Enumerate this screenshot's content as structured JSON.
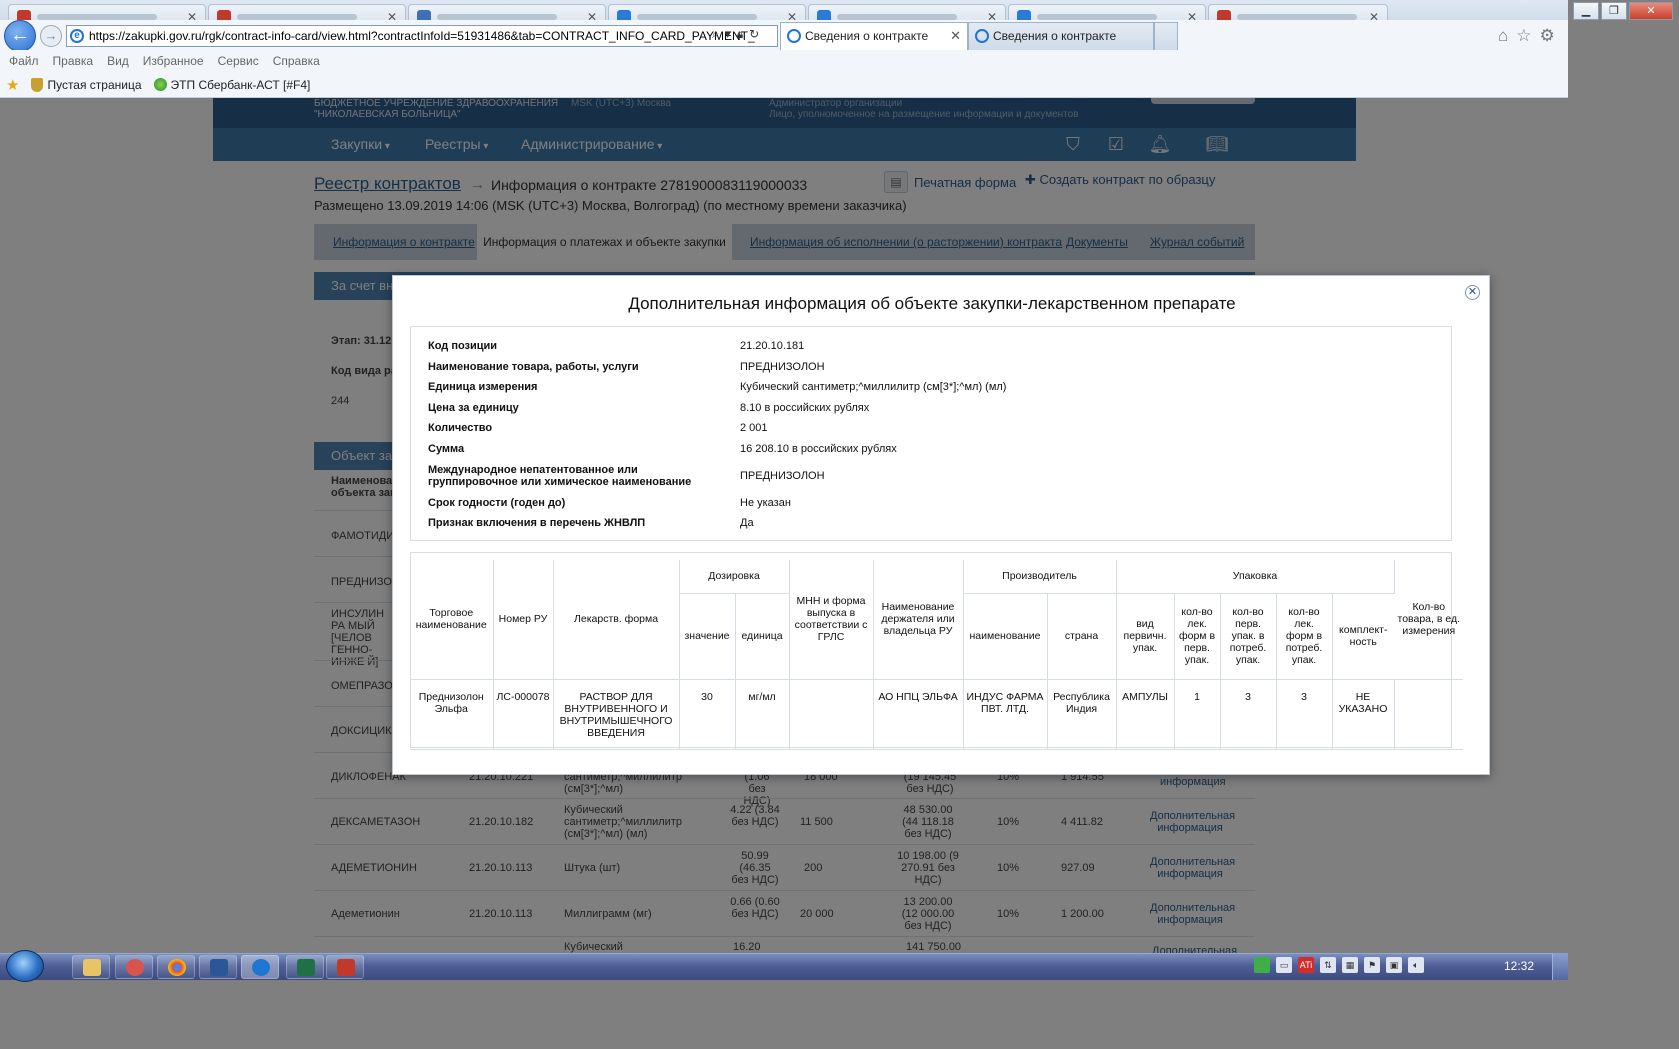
{
  "browser": {
    "url": "https://zakupki.gov.ru/rgk/contract-info-card/view.html?contractInfoId=51931486&tab=CONTRACT_INFO_CARD_PAYMENT_",
    "tab_active": "Сведения о контракте",
    "tab_other": "Сведения о контракте",
    "menu": [
      "Файл",
      "Правка",
      "Вид",
      "Избранное",
      "Сервис",
      "Справка"
    ],
    "favorites": [
      "Пустая страница",
      "ЭТП Сбербанк-АСТ [#F4]"
    ]
  },
  "site": {
    "org_line1": "БЮДЖЕТНОЕ УЧРЕЖДЕНИЕ ЗДРАВООХРАНЕНИЯ",
    "org_line2": "\"НИКОЛАЕВСКАЯ БОЛЬНИЦА\"",
    "timezone": "MSK (UTC+3) Москва",
    "role1": "Администратор организации",
    "role2": "Лицо, уполномоченное на размещение информации и документов",
    "nav": [
      "Закупки",
      "Реестры",
      "Администрирование"
    ]
  },
  "page": {
    "registry_link": "Реестр контрактов",
    "contract_title": "Информация о контракте 2781900083119000033",
    "print_form": "Печатная форма",
    "create_by_sample": "Создать контракт по образцу",
    "placed": "Размещено 13.09.2019 14:06 (MSK (UTC+3) Москва, Волгоград) (по местному времени заказчика)",
    "tabs": [
      "Информация о контракте",
      "Информация о платежах и объекте закупки",
      "Информация об исполнении (о расторжении) контракта",
      "Документы",
      "Журнал событий"
    ],
    "section1": "За счет вне",
    "stage": "Этап: 31.12.",
    "kod_vida": "Код вида ра",
    "kod_val": "244",
    "section2": "Объект зак",
    "col_name1": "Наименова",
    "col_name2": "объекта зак",
    "rows": [
      {
        "name": "ФАМОТИДИН"
      },
      {
        "name": "ПРЕДНИЗОЛО"
      },
      {
        "name": "ИНСУЛИН РА МЫЙ [ЧЕЛОВ ГЕННО-ИНЖЕ Й]"
      },
      {
        "name": "ОМЕПРАЗОЛ"
      },
      {
        "name": "ДОКСИЦИКЛ"
      },
      {
        "name": "ДИКЛОФЕНАК",
        "code": "21.20.10.221",
        "unit": "сантиметр;^миллилитр (см[3*];^мл)",
        "price": "(1.06 без НДС)",
        "qty": "18 000",
        "sum": "(19 145.45 без НДС)",
        "vat": "10%",
        "vat_sum": "1 914.55",
        "more": "информация"
      },
      {
        "name": "ДЕКСАМЕТАЗОН",
        "code": "21.20.10.182",
        "unit": "Кубический сантиметр;^миллилитр (см[3*];^мл) (мл)",
        "price": "4.22 (3.84 без НДС)",
        "qty": "11 500",
        "sum": "48 530.00 (44 118.18 без НДС)",
        "vat": "10%",
        "vat_sum": "4 411.82",
        "more": "Дополнительная информация"
      },
      {
        "name": "АДЕМЕТИОНИН",
        "code": "21.20.10.113",
        "unit": "Штука (шт)",
        "price": "50.99 (46.35 без НДС)",
        "qty": "200",
        "sum": "10 198.00 (9 270.91 без НДС)",
        "vat": "10%",
        "vat_sum": "927.09",
        "more": "Дополнительная информация"
      },
      {
        "name": "Адеметионин",
        "code": "21.20.10.113",
        "unit": "Миллиграмм (мг)",
        "price": "0.66 (0.60 без НДС)",
        "qty": "20 000",
        "sum": "13 200.00 (12 000.00 без НДС)",
        "vat": "10%",
        "vat_sum": "1 200.00",
        "more": "Дополнительная информация"
      },
      {
        "name": "",
        "unit": "Кубический",
        "price": "16.20",
        "sum": "141 750.00",
        "more": "Дополнительная"
      }
    ]
  },
  "modal": {
    "title": "Дополнительная информация об объекте закупки-лекарственном препарате",
    "fields": [
      {
        "label": "Код позиции",
        "value": "21.20.10.181"
      },
      {
        "label": "Наименование товара, работы, услуги",
        "value": "ПРЕДНИЗОЛОН"
      },
      {
        "label": "Единица измерения",
        "value": "Кубический сантиметр;^миллилитр (см[3*];^мл) (мл)"
      },
      {
        "label": "Цена за единицу",
        "value": "8.10 в российских рублях"
      },
      {
        "label": "Количество",
        "value": "2 001"
      },
      {
        "label": "Сумма",
        "value": "16 208.10 в российских рублях"
      },
      {
        "label": "Международное непатентованное или группировочное или химическое наименование",
        "value": "ПРЕДНИЗОЛОН"
      },
      {
        "label": "Срок годности (годен до)",
        "value": "Не указан"
      },
      {
        "label": "Признак включения в перечень ЖНВЛП",
        "value": "Да"
      }
    ],
    "table": {
      "group_dosage": "Дозировка",
      "group_manufacturer": "Производитель",
      "group_package": "Упаковка",
      "headers": {
        "trade_name": "Торговое наименование",
        "ru_number": "Номер РУ",
        "form": "Лекарств. форма",
        "dose_value": "значение",
        "dose_unit": "единица",
        "mnn": "МНН и форма выпуска в соответствии с ГРЛС",
        "holder": "Наименование держателя или владельца РУ",
        "mfr_name": "наименование",
        "mfr_country": "страна",
        "pack_type": "вид первичн. упак.",
        "pack_forms": "кол-во лек. форм в перв. упак.",
        "pack_cons": "кол-во перв. упак. в потреб. упак.",
        "pack_forms_cons": "кол-во лек. форм в потреб. упак.",
        "completeness": "комплект-ность",
        "qty_units": "Кол-во товара, в ед. измерения"
      },
      "row": {
        "trade_name": "Преднизолон Эльфа",
        "ru_number": "ЛС-000078",
        "form": "РАСТВОР ДЛЯ ВНУТРИВЕННОГО И ВНУТРИМЫШЕЧНОГО ВВЕДЕНИЯ",
        "dose_value": "30",
        "dose_unit": "мг/мл",
        "mnn": "",
        "holder": "АО НПЦ ЭЛЬФА",
        "mfr_name": "ИНДУС ФАРМА ПВТ. ЛТД.",
        "mfr_country": "Республика Индия",
        "pack_type": "АМПУЛЫ",
        "pack_forms": "1",
        "pack_cons": "3",
        "pack_forms_cons": "3",
        "completeness": "НЕ УКАЗАНО",
        "qty_units": ""
      }
    }
  },
  "taskbar": {
    "clock": "12:32"
  }
}
